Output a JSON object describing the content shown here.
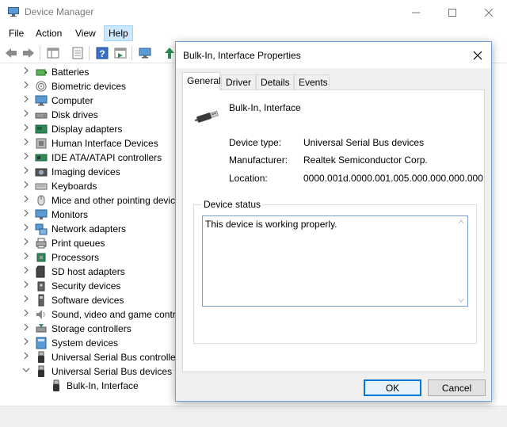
{
  "window": {
    "title": "Device Manager",
    "controls": [
      "minimize-icon",
      "maximize-icon",
      "close-icon"
    ]
  },
  "menu": {
    "file": "File",
    "action": "Action",
    "view": "View",
    "help": "Help"
  },
  "toolbar": {
    "buttons": [
      "back-icon",
      "forward-icon",
      "show-hide-console-tree-icon",
      "properties-icon",
      "help-icon",
      "action-pane-icon",
      "computer-icon",
      "update-driver-icon"
    ]
  },
  "tree": {
    "categories": [
      {
        "label": "Batteries",
        "icon": "battery-icon"
      },
      {
        "label": "Biometric devices",
        "icon": "fingerprint-icon"
      },
      {
        "label": "Computer",
        "icon": "computer-icon"
      },
      {
        "label": "Disk drives",
        "icon": "disk-drive-icon"
      },
      {
        "label": "Display adapters",
        "icon": "display-adapter-icon"
      },
      {
        "label": "Human Interface Devices",
        "icon": "hid-icon"
      },
      {
        "label": "IDE ATA/ATAPI controllers",
        "icon": "ide-controller-icon"
      },
      {
        "label": "Imaging devices",
        "icon": "camera-icon"
      },
      {
        "label": "Keyboards",
        "icon": "keyboard-icon"
      },
      {
        "label": "Mice and other pointing devic",
        "icon": "mouse-icon"
      },
      {
        "label": "Monitors",
        "icon": "monitor-icon"
      },
      {
        "label": "Network adapters",
        "icon": "network-adapter-icon"
      },
      {
        "label": "Print queues",
        "icon": "printer-icon"
      },
      {
        "label": "Processors",
        "icon": "processor-icon"
      },
      {
        "label": "SD host adapters",
        "icon": "sd-card-icon"
      },
      {
        "label": "Security devices",
        "icon": "security-device-icon"
      },
      {
        "label": "Software devices",
        "icon": "software-device-icon"
      },
      {
        "label": "Sound, video and game contr",
        "icon": "speaker-icon"
      },
      {
        "label": "Storage controllers",
        "icon": "storage-controller-icon"
      },
      {
        "label": "System devices",
        "icon": "system-device-icon"
      },
      {
        "label": "Universal Serial Bus controller",
        "icon": "usb-icon"
      },
      {
        "label": "Universal Serial Bus devices",
        "icon": "usb-icon",
        "expanded": true
      }
    ],
    "child": {
      "label": "Bulk-In, Interface",
      "icon": "usb-icon"
    }
  },
  "dialog": {
    "title": "Bulk-In, Interface Properties",
    "tabs": [
      "General",
      "Driver",
      "Details",
      "Events"
    ],
    "active_tab": "General",
    "device_name": "Bulk-In, Interface",
    "device_type_label": "Device type:",
    "device_type_value": "Universal Serial Bus devices",
    "manufacturer_label": "Manufacturer:",
    "manufacturer_value": "Realtek Semiconductor Corp.",
    "location_label": "Location:",
    "location_value": "0000.001d.0000.001.005.000.000.000.000",
    "status_group_label": "Device status",
    "status_text": "This device is working properly.",
    "ok_label": "OK",
    "cancel_label": "Cancel"
  },
  "colors": {
    "accent": "#0078d7",
    "help_menu_highlight": "#cce8ff",
    "dialog_border": "#6d9fd8",
    "dialog_background": "#f0f0f0"
  }
}
